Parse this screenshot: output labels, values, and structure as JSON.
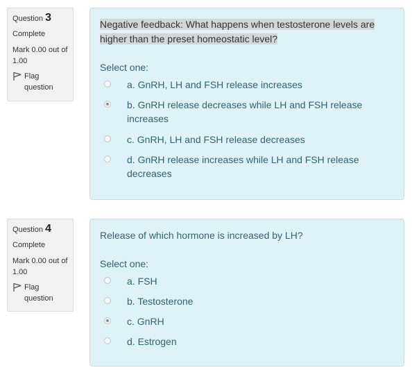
{
  "questions": [
    {
      "label": "Question",
      "number": "3",
      "state": "Complete",
      "grade": "Mark 0.00 out of 1.00",
      "flag_label": "Flag question",
      "text": "Negative feedback: What happens when testosterone levels are higher than the preset homeostatic level?",
      "prompt": "Select one:",
      "options": [
        {
          "label": "a. GnRH, LH and FSH release increases",
          "selected": false
        },
        {
          "label": "b. GnRH release decreases while LH and FSH release increases",
          "selected": true
        },
        {
          "label": "c. GnRH, LH and FSH release decreases",
          "selected": false
        },
        {
          "label": "d. GnRH release increases while LH and FSH release decreases",
          "selected": false
        }
      ]
    },
    {
      "label": "Question",
      "number": "4",
      "state": "Complete",
      "grade": "Mark 0.00 out of 1.00",
      "flag_label": "Flag question",
      "text": "Release of which hormone is increased by LH?",
      "prompt": "Select one:",
      "options": [
        {
          "label": "a. FSH",
          "selected": false
        },
        {
          "label": "b. Testosterone",
          "selected": false
        },
        {
          "label": "c. GnRH",
          "selected": true
        },
        {
          "label": "d. Estrogen",
          "selected": false
        }
      ]
    }
  ]
}
